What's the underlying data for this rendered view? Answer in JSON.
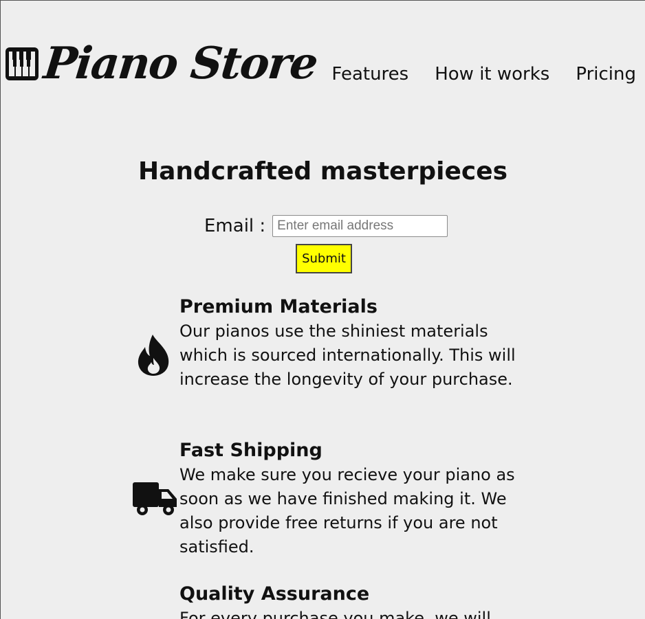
{
  "header": {
    "logo_text": "Piano Store",
    "logo_icon": "piano-keys-icon",
    "nav": [
      {
        "label": "Features"
      },
      {
        "label": "How it works"
      },
      {
        "label": "Pricing"
      }
    ]
  },
  "hero": {
    "title": "Handcrafted masterpieces",
    "email_label": "Email :",
    "email_placeholder": "Enter email address",
    "email_value": "",
    "submit_label": "Submit"
  },
  "features": [
    {
      "icon": "fire-icon",
      "title": "Premium Materials",
      "text": "Our pianos use the shiniest materials which is sourced internationally. This will increase the longevity of your purchase."
    },
    {
      "icon": "truck-icon",
      "title": "Fast Shipping",
      "text": "We make sure you recieve your piano as soon as we have finished making it. We also provide free returns if you are not satisfied."
    },
    {
      "icon": "",
      "title": "Quality Assurance",
      "text": "For every purchase you make, we will"
    }
  ],
  "colors": {
    "background": "#eeeeee",
    "submit_button": "#ffff00",
    "text": "#111111"
  }
}
